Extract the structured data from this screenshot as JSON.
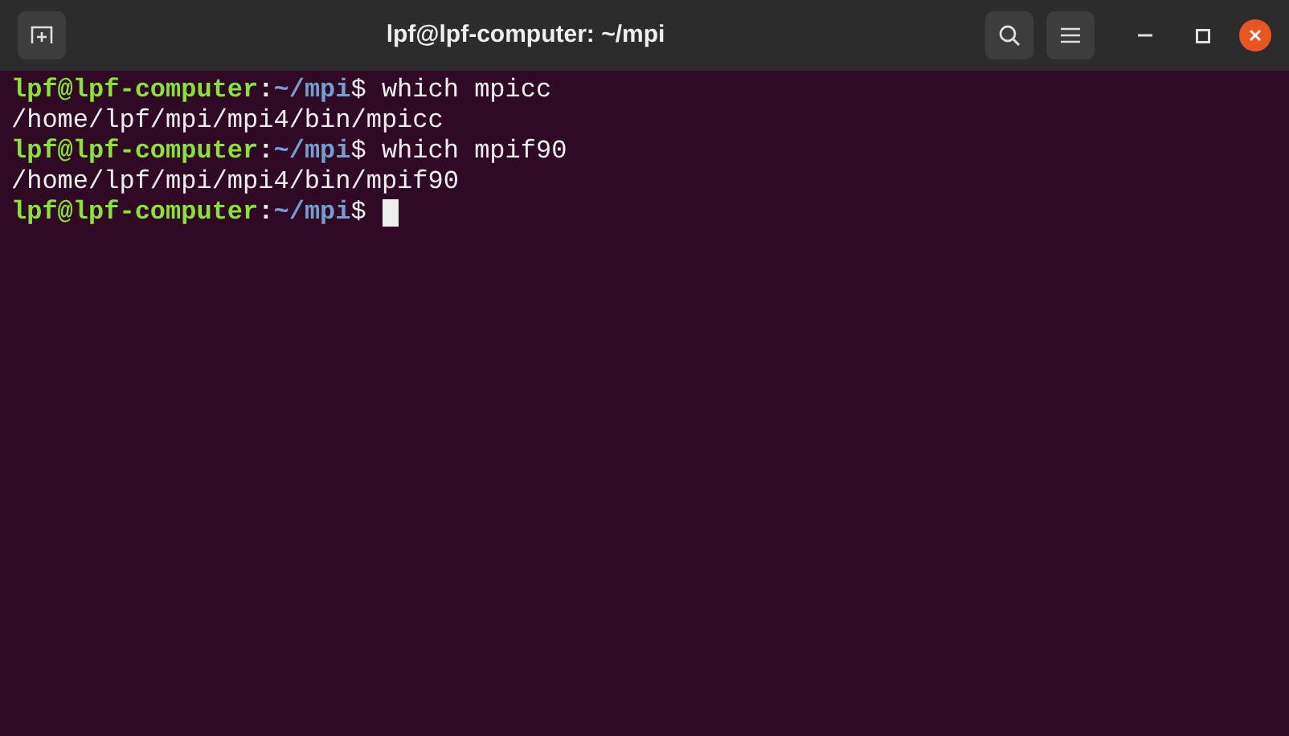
{
  "window": {
    "title": "lpf@lpf-computer: ~/mpi"
  },
  "terminal": {
    "lines": [
      {
        "kind": "prompt",
        "user": "lpf@lpf-computer",
        "separator": ":",
        "path": "~/mpi",
        "command": "$ which mpicc",
        "cursor": false
      },
      {
        "kind": "output",
        "text": "/home/lpf/mpi/mpi4/bin/mpicc"
      },
      {
        "kind": "prompt",
        "user": "lpf@lpf-computer",
        "separator": ":",
        "path": "~/mpi",
        "command": "$ which mpif90",
        "cursor": false
      },
      {
        "kind": "output",
        "text": "/home/lpf/mpi/mpi4/bin/mpif90"
      },
      {
        "kind": "prompt",
        "user": "lpf@lpf-computer",
        "separator": ":",
        "path": "~/mpi",
        "command": "$",
        "cursor": true
      }
    ]
  }
}
